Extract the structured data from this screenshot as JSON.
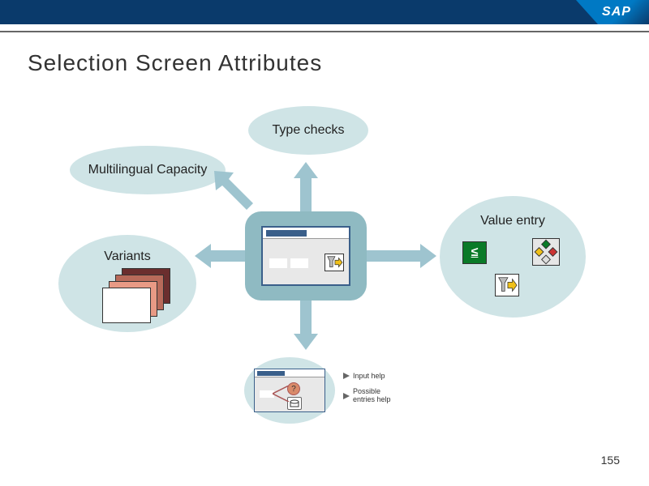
{
  "header": {
    "logo_text": "SAP"
  },
  "title": "Selection Screen Attributes",
  "bubbles": {
    "type_checks": "Type checks",
    "multilingual": "Multilingual Capacity",
    "variants": "Variants",
    "value_entry": "Value entry"
  },
  "value_entry_icons": {
    "le_symbol": "≤"
  },
  "help": {
    "question_mark": "?",
    "input_help": "Input help",
    "possible_entries": "Possible entries help"
  },
  "page_number": "155"
}
